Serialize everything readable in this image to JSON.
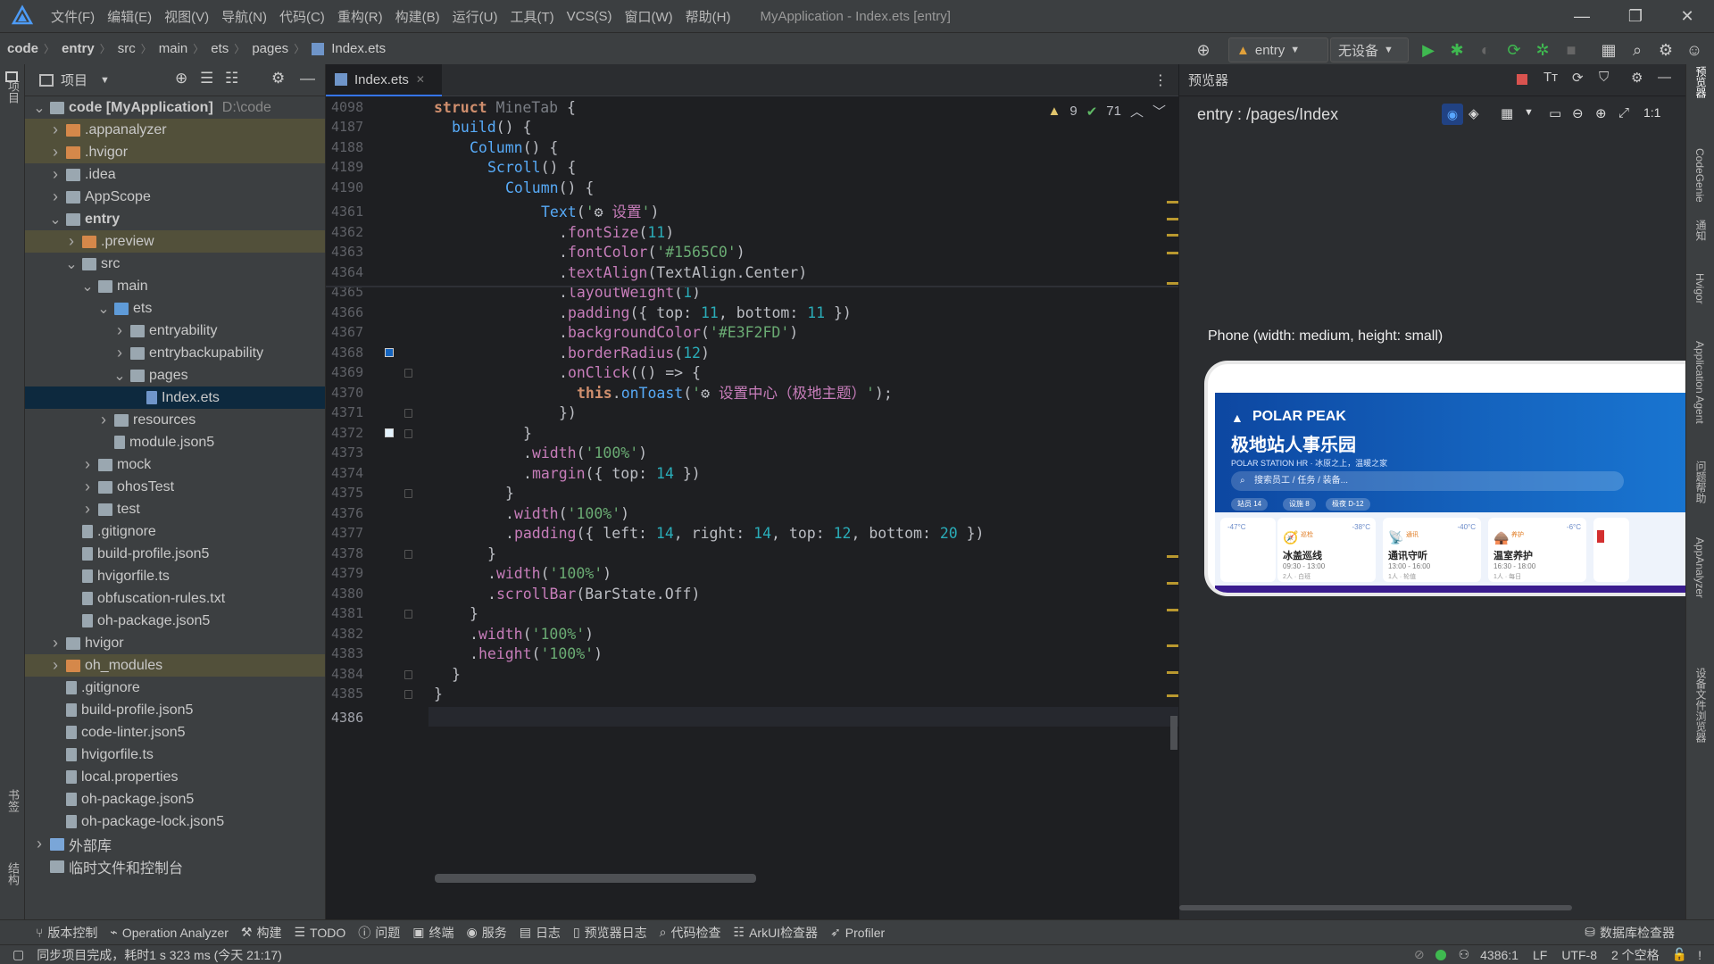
{
  "menubar": {
    "items": [
      "文件(F)",
      "编辑(E)",
      "视图(V)",
      "导航(N)",
      "代码(C)",
      "重构(R)",
      "构建(B)",
      "运行(U)",
      "工具(T)",
      "VCS(S)",
      "窗口(W)",
      "帮助(H)"
    ],
    "title": "MyApplication - Index.ets [entry]"
  },
  "breadcrumb": [
    "code",
    "entry",
    "src",
    "main",
    "ets",
    "pages",
    "Index.ets"
  ],
  "toolbar": {
    "module": "entry",
    "device": "无设备"
  },
  "project_panel": {
    "title": "项目",
    "tree": [
      {
        "label": "code [MyApplication]",
        "path": "D:\\code",
        "bold": true,
        "depth": 0,
        "arrow": "down",
        "type": "folder"
      },
      {
        "label": ".appanalyzer",
        "depth": 1,
        "arrow": "right",
        "type": "folder-orange",
        "excl": true
      },
      {
        "label": ".hvigor",
        "depth": 1,
        "arrow": "right",
        "type": "folder-orange",
        "excl": true
      },
      {
        "label": ".idea",
        "depth": 1,
        "arrow": "right",
        "type": "folder"
      },
      {
        "label": "AppScope",
        "depth": 1,
        "arrow": "right",
        "type": "folder"
      },
      {
        "label": "entry",
        "depth": 1,
        "arrow": "down",
        "type": "folder-mod",
        "bold": true
      },
      {
        "label": ".preview",
        "depth": 2,
        "arrow": "right",
        "type": "folder-orange",
        "excl": true
      },
      {
        "label": "src",
        "depth": 2,
        "arrow": "down",
        "type": "folder"
      },
      {
        "label": "main",
        "depth": 3,
        "arrow": "down",
        "type": "folder"
      },
      {
        "label": "ets",
        "depth": 4,
        "arrow": "down",
        "type": "folder-blue"
      },
      {
        "label": "entryability",
        "depth": 5,
        "arrow": "right",
        "type": "folder"
      },
      {
        "label": "entrybackupability",
        "depth": 5,
        "arrow": "right",
        "type": "folder"
      },
      {
        "label": "pages",
        "depth": 5,
        "arrow": "down",
        "type": "folder"
      },
      {
        "label": "Index.ets",
        "depth": 6,
        "arrow": "",
        "type": "file-ets",
        "sel": true
      },
      {
        "label": "resources",
        "depth": 4,
        "arrow": "right",
        "type": "folder"
      },
      {
        "label": "module.json5",
        "depth": 4,
        "arrow": "",
        "type": "file"
      },
      {
        "label": "mock",
        "depth": 3,
        "arrow": "right",
        "type": "folder"
      },
      {
        "label": "ohosTest",
        "depth": 3,
        "arrow": "right",
        "type": "folder"
      },
      {
        "label": "test",
        "depth": 3,
        "arrow": "right",
        "type": "folder"
      },
      {
        "label": ".gitignore",
        "depth": 2,
        "arrow": "",
        "type": "file"
      },
      {
        "label": "build-profile.json5",
        "depth": 2,
        "arrow": "",
        "type": "file"
      },
      {
        "label": "hvigorfile.ts",
        "depth": 2,
        "arrow": "",
        "type": "file"
      },
      {
        "label": "obfuscation-rules.txt",
        "depth": 2,
        "arrow": "",
        "type": "file"
      },
      {
        "label": "oh-package.json5",
        "depth": 2,
        "arrow": "",
        "type": "file"
      },
      {
        "label": "hvigor",
        "depth": 1,
        "arrow": "right",
        "type": "folder"
      },
      {
        "label": "oh_modules",
        "depth": 1,
        "arrow": "right",
        "type": "folder-orange",
        "excl": true
      },
      {
        "label": ".gitignore",
        "depth": 1,
        "arrow": "",
        "type": "file"
      },
      {
        "label": "build-profile.json5",
        "depth": 1,
        "arrow": "",
        "type": "file"
      },
      {
        "label": "code-linter.json5",
        "depth": 1,
        "arrow": "",
        "type": "file"
      },
      {
        "label": "hvigorfile.ts",
        "depth": 1,
        "arrow": "",
        "type": "file"
      },
      {
        "label": "local.properties",
        "depth": 1,
        "arrow": "",
        "type": "file"
      },
      {
        "label": "oh-package.json5",
        "depth": 1,
        "arrow": "",
        "type": "file"
      },
      {
        "label": "oh-package-lock.json5",
        "depth": 1,
        "arrow": "",
        "type": "file"
      },
      {
        "label": "外部库",
        "depth": 0,
        "arrow": "right",
        "type": "lib"
      },
      {
        "label": "临时文件和控制台",
        "depth": 0,
        "arrow": "",
        "type": "scratch"
      }
    ]
  },
  "editor": {
    "tab": "Index.ets",
    "warnings": "9",
    "checks": "71",
    "line_numbers": [
      "4098",
      "4187",
      "4188",
      "4189",
      "4190",
      "4361",
      "4362",
      "4363",
      "4364",
      "4365",
      "4366",
      "4367",
      "4368",
      "4369",
      "4370",
      "4371",
      "4372",
      "4373",
      "4374",
      "4375",
      "4376",
      "4377",
      "4378",
      "4379",
      "4380",
      "4381",
      "4382",
      "4383",
      "4384",
      "4385",
      "4386"
    ]
  },
  "preview": {
    "title": "预览器",
    "route": "entry : /pages/Index",
    "device_label": "Phone (width: medium, height: small)",
    "app": {
      "brand": "POLAR PEAK",
      "title": "极地站人事乐园",
      "subtitle": "POLAR STATION HR · 冰原之上，温暖之家",
      "search": "搜索员工 / 任务 / 装备...",
      "chips": [
        "站员 14",
        "设施 8",
        "极夜 D-12"
      ],
      "cards": [
        {
          "tmp": "-47°C",
          "tag": "巡检",
          "tmp2": "-38°C",
          "name": "冰盖巡线",
          "time": "09:30 - 13:00",
          "role": "2人 · 白班"
        },
        {
          "tmp": "",
          "tag": "通讯",
          "tmp2": "-40°C",
          "name": "通讯守听",
          "time": "13:00 - 16:00",
          "role": "1人 · 轮值"
        },
        {
          "tmp": "",
          "tag": "养护",
          "tmp2": "-6°C",
          "name": "温室养护",
          "time": "16:30 - 18:00",
          "role": "1人 · 每日"
        }
      ]
    }
  },
  "right_strip": [
    "预览器",
    "CodeGenie",
    "通知",
    "Hvigor",
    "Application Agent",
    "问题帮助",
    "AppAnalyzer",
    "设备文件浏览器"
  ],
  "left_strip": [
    "项目",
    "书签",
    "结构"
  ],
  "bottom_tools": [
    "版本控制",
    "Operation Analyzer",
    "构建",
    "TODO",
    "问题",
    "终端",
    "服务",
    "日志",
    "预览器日志",
    "代码检查",
    "ArkUI检查器",
    "Profiler",
    "数据库检查器"
  ],
  "status": {
    "message": "同步项目完成，耗时1 s 323 ms (今天 21:17)",
    "position": "4386:1",
    "line_sep": "LF",
    "encoding": "UTF-8",
    "indent": "2 个空格"
  },
  "colors": {
    "accent": "#3574f0",
    "font_color_value": "#1565C0",
    "bg_value": "#E3F2FD"
  }
}
